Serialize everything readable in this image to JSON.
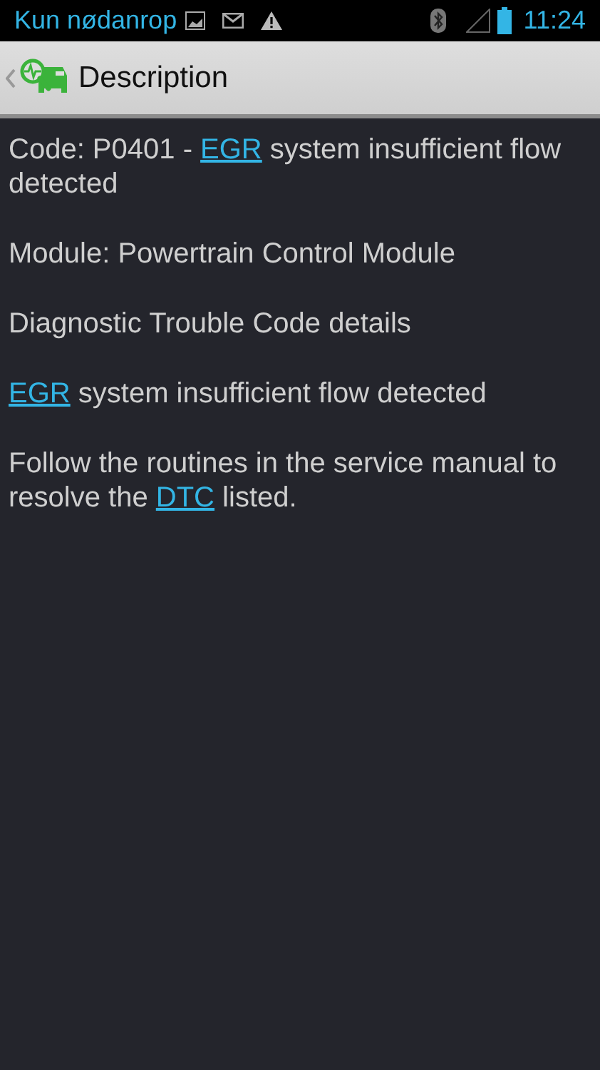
{
  "status_bar": {
    "notification": "Kun nødanrop",
    "time": "11:24"
  },
  "action_bar": {
    "title": "Description"
  },
  "paragraphs": [
    [
      {
        "text": "Code: P0401 - ",
        "link": false
      },
      {
        "text": "EGR",
        "link": true
      },
      {
        "text": " system insufficient flow detected",
        "link": false
      }
    ],
    [
      {
        "text": "Module: Powertrain Control Module",
        "link": false
      }
    ],
    [
      {
        "text": "Diagnostic Trouble Code details",
        "link": false
      }
    ],
    [
      {
        "text": "EGR",
        "link": true
      },
      {
        "text": " system insufficient flow detected",
        "link": false
      }
    ],
    [
      {
        "text": "Follow the routines in the service manual to resolve the ",
        "link": false
      },
      {
        "text": "DTC",
        "link": true
      },
      {
        "text": " listed.",
        "link": false
      }
    ]
  ]
}
